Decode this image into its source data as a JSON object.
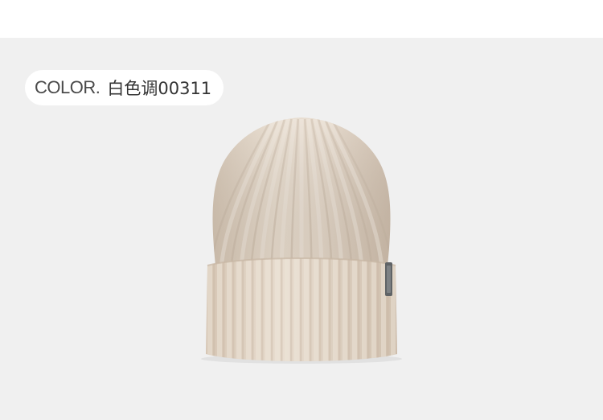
{
  "label": {
    "prefix": "COLOR.",
    "value": "白色调00311"
  },
  "colors": {
    "background": "#f0f0f0",
    "hat_base": "#e2d5c6",
    "hat_light": "#eee5da",
    "hat_shadow": "#c9b8a6",
    "tag": "#5f6366"
  },
  "icons": {
    "product": "knit-beanie-hat",
    "tag": "brand-label-tag"
  }
}
